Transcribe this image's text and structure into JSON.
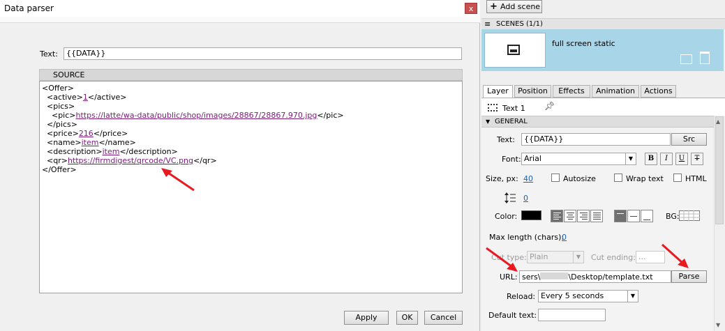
{
  "dialog": {
    "title": "Data parser",
    "close_glyph": "x",
    "text_label": "Text:",
    "text_value": "{{DATA}}",
    "source_header": "SOURCE",
    "source_lines": [
      {
        "pre": "<Offer>",
        "link": "",
        "post": ""
      },
      {
        "pre": "  <active>",
        "link": "1",
        "post": "</active>"
      },
      {
        "pre": "  <pics>",
        "link": "",
        "post": ""
      },
      {
        "pre": "    <pic>",
        "link": "https://latte/wa-data/public/shop/images/28867/28867.970.jpg",
        "post": "</pic>"
      },
      {
        "pre": "  </pics>",
        "link": "",
        "post": ""
      },
      {
        "pre": "  <price>",
        "link": "216",
        "post": "</price>"
      },
      {
        "pre": "  <name>",
        "link": "item",
        "post": "</name>"
      },
      {
        "pre": "  <description>",
        "link": "item",
        "post": "</description>"
      },
      {
        "pre": "  <qr>",
        "link": "https://firmdigest/qrcode/VC.png",
        "post": "</qr>"
      },
      {
        "pre": "</Offer>",
        "link": "",
        "post": ""
      }
    ],
    "apply_label": "Apply",
    "ok_label": "OK",
    "cancel_label": "Cancel"
  },
  "scenes": {
    "add_scene_label": "Add scene",
    "header": "SCENES (1/1)",
    "scene_name": "full screen static"
  },
  "tabs": [
    "Layer",
    "Position",
    "Effects",
    "Animation",
    "Actions"
  ],
  "layer": {
    "name": "Text 1",
    "general_header": "GENERAL",
    "text_label": "Text:",
    "text_value": "{{DATA}}",
    "src_label": "Src",
    "font_label": "Font:",
    "font_value": "Arial",
    "bold": "B",
    "italic": "I",
    "underline": "U",
    "strike": "T",
    "size_label": "Size, px:",
    "size_value": "40",
    "autosize_label": "Autosize",
    "wrap_label": "Wrap text",
    "html_label": "HTML",
    "line_spacing_value": "0",
    "color_label": "Color:",
    "text_color": "#000000",
    "bg_label": "BG:",
    "max_length_label": "Max length (chars):",
    "max_length_value": "0",
    "cut_type_label": "Cut type:",
    "cut_type_value": "Plain",
    "cut_ending_label": "Cut ending:",
    "cut_ending_value": "...",
    "url_label": "URL:",
    "url_prefix": "sers\\",
    "url_suffix": "\\Desktop/template.txt",
    "parse_label": "Parse",
    "reload_label": "Reload:",
    "reload_value": "Every 5 seconds",
    "default_text_label": "Default text:",
    "default_text_value": ""
  },
  "colors": {
    "scene_highlight": "#a8d5e8",
    "annotation_arrow": "#e8191f",
    "link": "#7a1a7a"
  }
}
